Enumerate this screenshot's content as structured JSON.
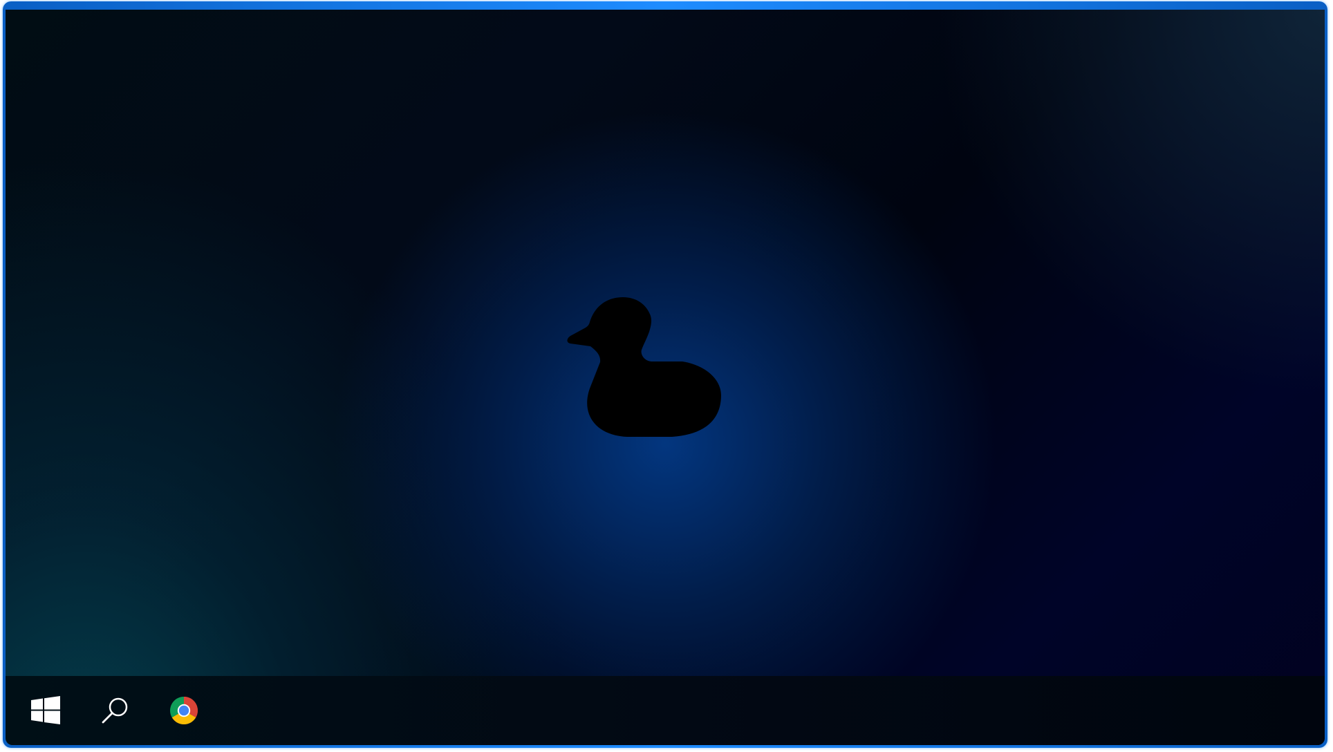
{
  "desktop": {
    "wallpaper_logo": "duck-silhouette-icon",
    "accent_color": "#1e8cff"
  },
  "taskbar": {
    "items": [
      {
        "icon": "windows-start-icon"
      },
      {
        "icon": "search-icon"
      },
      {
        "icon": "chrome-icon"
      }
    ]
  }
}
